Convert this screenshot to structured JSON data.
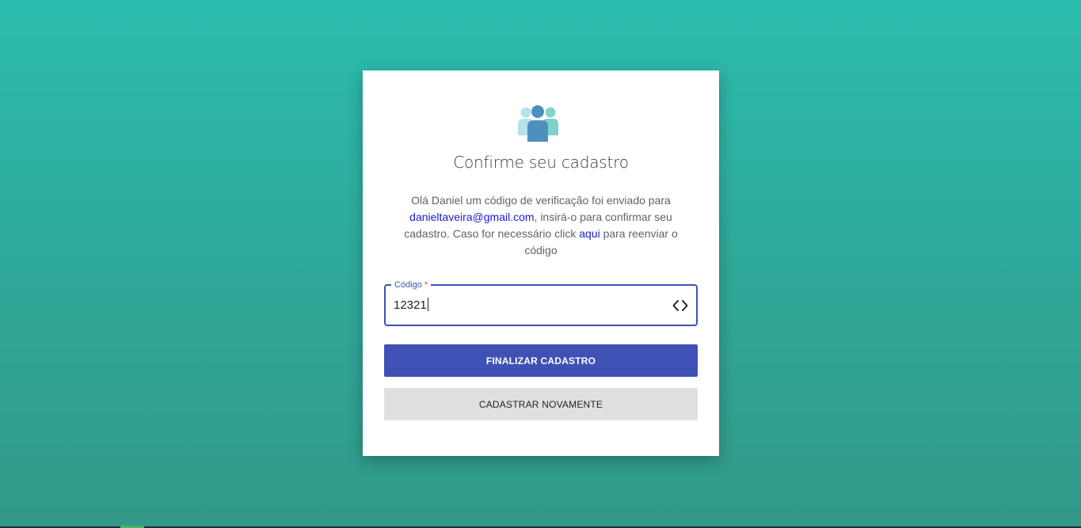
{
  "card": {
    "title": "Confirme seu cadastro",
    "logo_icon": "users-group-icon",
    "description": {
      "part1": "Olá Daniel um código de verificação foi enviado para ",
      "email": "danieltaveira@gmail.com",
      "part2": ", insirá-o para confirmar seu cadastro. Caso for necessário click ",
      "resend_link": "aqui",
      "part3": " para reenviar o código"
    }
  },
  "form": {
    "code_label": "Código",
    "required_mark": "*",
    "code_value": "12321",
    "code_icon": "code-brackets-icon"
  },
  "buttons": {
    "finalize": "FINALIZAR CADASTRO",
    "register_again": "CADASTRAR NOVAMENTE"
  },
  "colors": {
    "background_top": "#2bbcad",
    "background_bottom": "#329889",
    "primary": "#3f51b5",
    "secondary_button": "#e0e0e0",
    "link": "#1a1ad4",
    "required": "#f44336"
  }
}
